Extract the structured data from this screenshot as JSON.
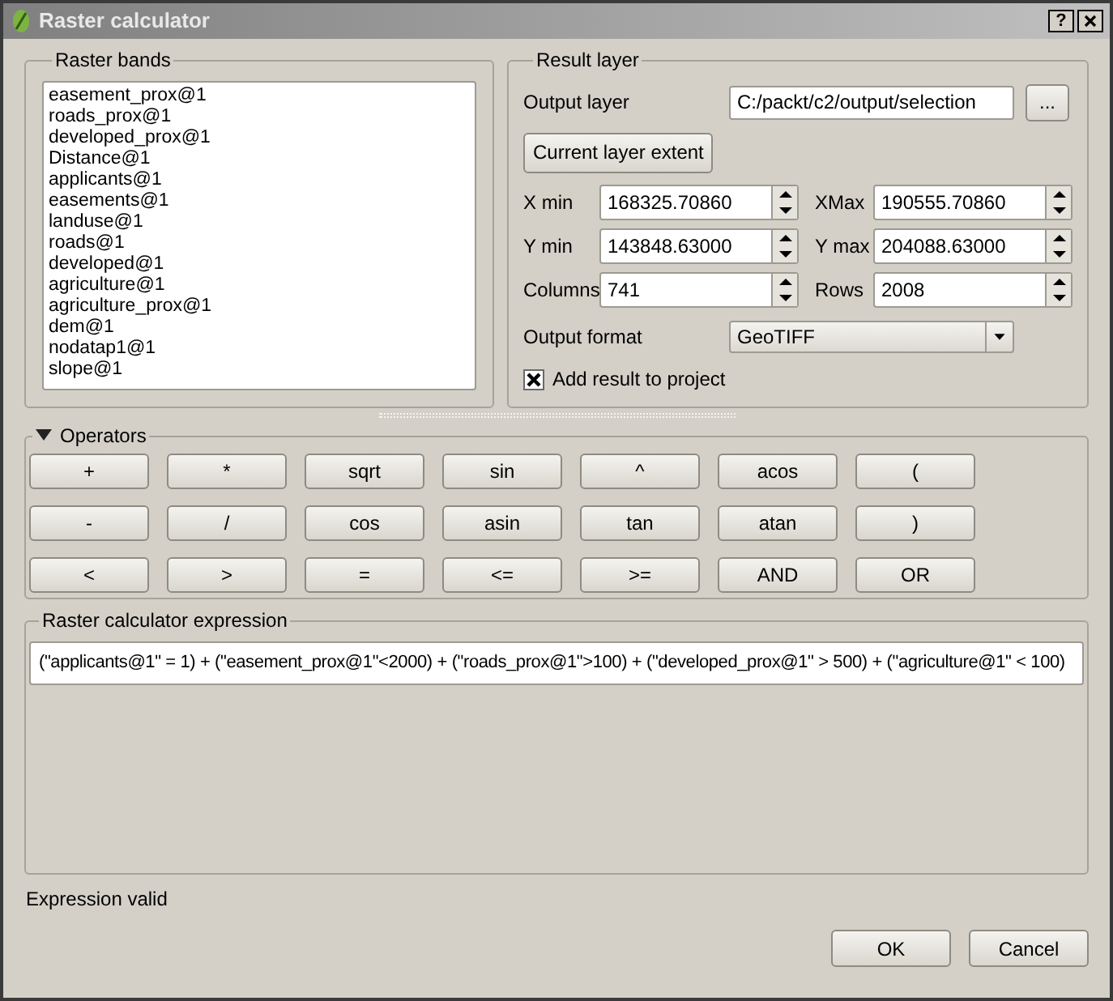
{
  "window": {
    "title": "Raster calculator",
    "help_button": "?"
  },
  "raster_bands": {
    "title": "Raster bands",
    "items": [
      "easement_prox@1",
      "roads_prox@1",
      "developed_prox@1",
      "Distance@1",
      "applicants@1",
      "easements@1",
      "landuse@1",
      "roads@1",
      "developed@1",
      "agriculture@1",
      "agriculture_prox@1",
      "dem@1",
      "nodatap1@1",
      "slope@1"
    ]
  },
  "result_layer": {
    "title": "Result layer",
    "output_layer": {
      "label": "Output layer",
      "value": "C:/packt/c2/output/selection"
    },
    "browse_button": "...",
    "extent_button": "Current layer extent",
    "fields": [
      {
        "label": "X min",
        "value": "168325.70860"
      },
      {
        "label": "XMax",
        "value": "190555.70860"
      },
      {
        "label": "Y min",
        "value": "143848.63000"
      },
      {
        "label": "Y max",
        "value": "204088.63000"
      },
      {
        "label": "Columns",
        "value": "741"
      },
      {
        "label": "Rows",
        "value": "2008"
      }
    ],
    "output_format": {
      "label": "Output format",
      "value": "GeoTIFF"
    },
    "add_to_project": {
      "label": "Add result to project",
      "checked": true
    }
  },
  "operators": {
    "title": "Operators",
    "expanded": true,
    "buttons": [
      "+",
      "*",
      "sqrt",
      "sin",
      "^",
      "acos",
      "(",
      "-",
      "/",
      "cos",
      "asin",
      "tan",
      "atan",
      ")",
      "<",
      ">",
      "=",
      "<=",
      ">=",
      "AND",
      "OR"
    ]
  },
  "expression": {
    "title": "Raster calculator expression",
    "value": "(\"applicants@1\" = 1) + (\"easement_prox@1\"<2000) + (\"roads_prox@1\">100) + (\"developed_prox@1\" > 500) + (\"agriculture@1\" < 100)"
  },
  "status": "Expression valid",
  "buttons": [
    "OK",
    "Cancel"
  ]
}
